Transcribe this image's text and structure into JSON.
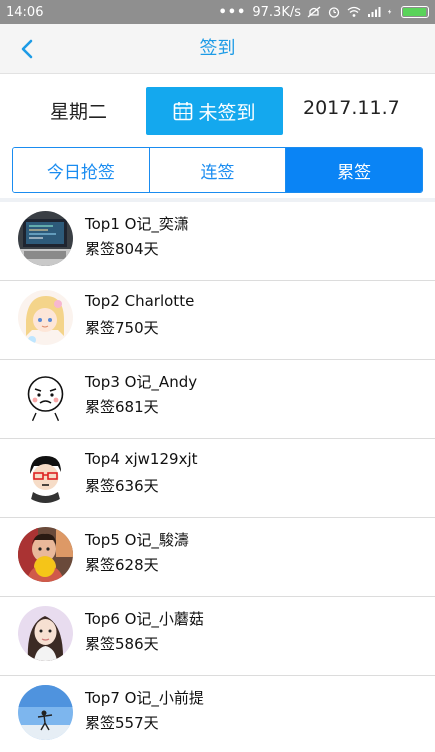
{
  "status_bar": {
    "time": "14:06",
    "dots": "•••",
    "speed": "97.3K/s",
    "battery_level": 0.95
  },
  "header": {
    "title": "签到"
  },
  "sign_row": {
    "weekday": "星期二",
    "button_label": "未签到",
    "date": "2017.11.7"
  },
  "tabs": [
    {
      "label": "今日抢签",
      "active": false
    },
    {
      "label": "连签",
      "active": false
    },
    {
      "label": "累签",
      "active": true
    }
  ],
  "list": [
    {
      "name": "Top1 O记_奕潇",
      "days": "累签804天",
      "avatar": "laptop-photo"
    },
    {
      "name": "Top2 Charlotte",
      "days": "累签750天",
      "avatar": "anime-girl"
    },
    {
      "name": "Top3 O记_Andy",
      "days": "累签681天",
      "avatar": "sad-face-sketch"
    },
    {
      "name": "Top4 xjw129xjt",
      "days": "累签636天",
      "avatar": "glasses-cartoon"
    },
    {
      "name": "Top5 O记_駿濤",
      "days": "累签628天",
      "avatar": "child-photo"
    },
    {
      "name": "Top6 O记_小蘑菇",
      "days": "累签586天",
      "avatar": "girl-portrait"
    },
    {
      "name": "Top7 O记_小前提",
      "days": "累签557天",
      "avatar": "beach-photo"
    }
  ],
  "colors": {
    "accent": "#1d9be6",
    "button": "#14a8ee",
    "tab_active": "#0a84f5",
    "status_bar": "#8f8f8f"
  }
}
